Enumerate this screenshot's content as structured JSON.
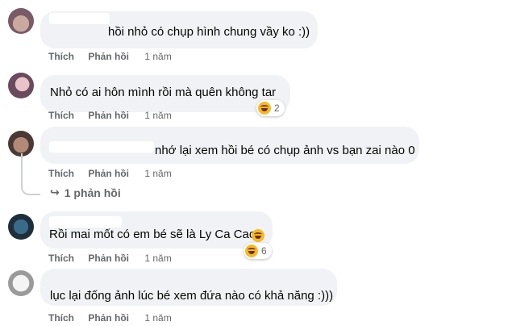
{
  "comments": [
    {
      "text": "hồi nhỏ có chụp hình chung vầy ko :))",
      "like": "Thích",
      "reply": "Phản hồi",
      "time": "1 năm"
    },
    {
      "text": "Nhỏ có ai hôn mình rồi mà quên không tar",
      "like": "Thích",
      "reply": "Phản hồi",
      "time": "1 năm",
      "reaction": {
        "icon": "haha-emoji-icon",
        "count": "2"
      }
    },
    {
      "text": "nhớ lại xem hồi bé có chụp ảnh vs bạn zai nào 0",
      "like": "Thích",
      "reply": "Phản hồi",
      "time": "1 năm",
      "replies_label": "1 phản hồi"
    },
    {
      "text": "Rồi mai mốt có em bé sẽ là Ly Ca Cao",
      "like": "Thích",
      "reply": "Phản hồi",
      "time": "1 năm",
      "reaction": {
        "icon": "haha-emoji-icon",
        "count": "6"
      }
    },
    {
      "text": "lục lại đống ảnh lúc bé xem đứa nào có khả năng :)))",
      "like": "Thích",
      "reply": "Phản hồi",
      "time": "1 năm"
    }
  ],
  "colors": {
    "bubble": "#f0f2f5",
    "action_text": "#65676b",
    "haha": "#f7b928"
  }
}
